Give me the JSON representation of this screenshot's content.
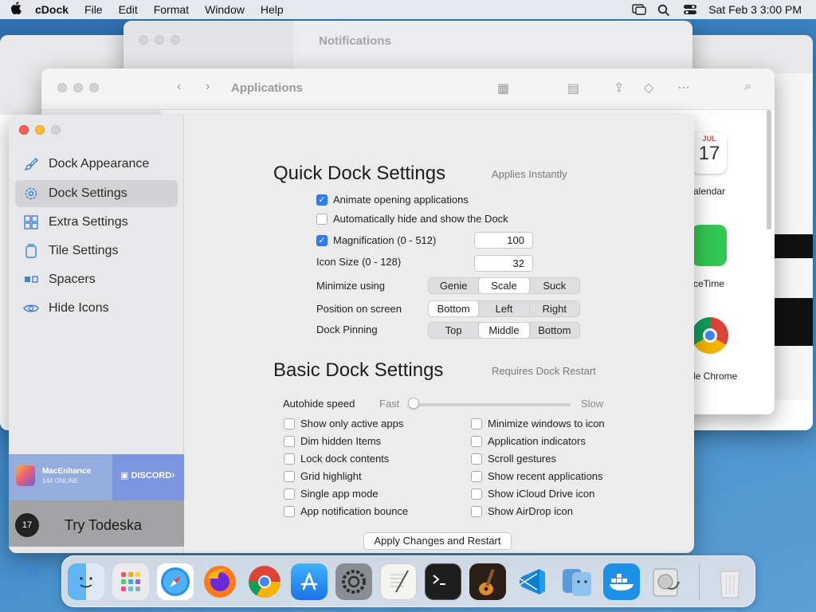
{
  "menubar": {
    "app_name": "cDock",
    "items": [
      "File",
      "Edit",
      "Format",
      "Window",
      "Help"
    ],
    "clock": "Sat Feb 3  3:00 PM"
  },
  "notifications_window": {
    "title": "Notifications"
  },
  "finder_window": {
    "title": "Applications",
    "peek_labels": [
      "JUL",
      "17",
      "alendar",
      "ceTime",
      "le Chrome"
    ]
  },
  "sidebar": {
    "items": [
      {
        "label": "Dock Appearance",
        "icon": "paintbrush-icon"
      },
      {
        "label": "Dock Settings",
        "icon": "gear-icon",
        "active": true
      },
      {
        "label": "Extra Settings",
        "icon": "grid-icon"
      },
      {
        "label": "Tile Settings",
        "icon": "tile-icon"
      },
      {
        "label": "Spacers",
        "icon": "spacer-icon"
      },
      {
        "label": "Hide Icons",
        "icon": "eye-icon"
      }
    ],
    "macenhance": {
      "name": "MacEnhance",
      "online": "144 ONLINE",
      "discord": "DISCORD"
    },
    "todeska": {
      "label": "Try Todeska",
      "date": "17"
    }
  },
  "quick": {
    "title": "Quick Dock Settings",
    "note": "Applies Instantly",
    "animate": "Animate opening applications",
    "autohide": "Automatically hide and show the Dock",
    "magnification": "Magnification (0 - 512)",
    "magnification_value": "100",
    "icon_size": "Icon Size (0 - 128)",
    "icon_size_value": "32",
    "minimize_label": "Minimize using",
    "minimize_options": [
      "Genie",
      "Scale",
      "Suck"
    ],
    "position_label": "Position on screen",
    "position_options": [
      "Bottom",
      "Left",
      "Right"
    ],
    "pinning_label": "Dock Pinning",
    "pinning_options": [
      "Top",
      "Middle",
      "Bottom"
    ]
  },
  "basic": {
    "title": "Basic Dock Settings",
    "note": "Requires Dock Restart",
    "autohide_speed": "Autohide speed",
    "fast": "Fast",
    "slow": "Slow",
    "left_options": [
      "Show only active apps",
      "Dim hidden Items",
      "Lock dock contents",
      "Grid highlight",
      "Single app mode",
      "App notification bounce"
    ],
    "right_options": [
      "Minimize windows to icon",
      "Application indicators",
      "Scroll gestures",
      "Show recent applications",
      "Show iCloud Drive icon",
      "Show AirDrop icon"
    ],
    "apply": "Apply Changes and Restart"
  },
  "dock": {
    "apps": [
      "Finder",
      "Launchpad",
      "Safari",
      "Firefox",
      "Chrome",
      "App Store",
      "System Settings",
      "TextEdit",
      "Terminal",
      "GarageBand",
      "VS Code",
      "Migration Assistant",
      "Docker",
      "Disk Utility",
      "Trash"
    ]
  },
  "colors": {
    "accent": "#2f7cf6",
    "wallpaper": "#3b86c7"
  }
}
